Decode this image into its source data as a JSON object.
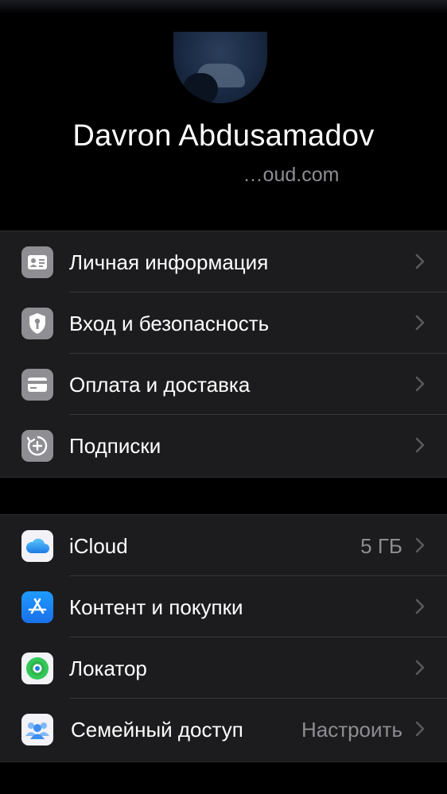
{
  "profile": {
    "name": "Davron Abdusamadov",
    "email": "…oud.com"
  },
  "group1": [
    {
      "label": "Личная информация",
      "icon": "id-card-icon"
    },
    {
      "label": "Вход и безопасность",
      "icon": "shield-key-icon"
    },
    {
      "label": "Оплата и доставка",
      "icon": "credit-card-icon"
    },
    {
      "label": "Подписки",
      "icon": "subscriptions-icon"
    }
  ],
  "group2": [
    {
      "label": "iCloud",
      "value": "5 ГБ",
      "icon": "icloud-icon"
    },
    {
      "label": "Контент и покупки",
      "icon": "app-store-icon"
    },
    {
      "label": "Локатор",
      "icon": "find-my-icon"
    },
    {
      "label": "Семейный доступ",
      "value": "Настроить",
      "icon": "family-sharing-icon"
    }
  ],
  "colors": {
    "background": "#000000",
    "cell": "#1c1c1e",
    "secondary_text": "#8d8d93",
    "separator": "#38383a"
  }
}
